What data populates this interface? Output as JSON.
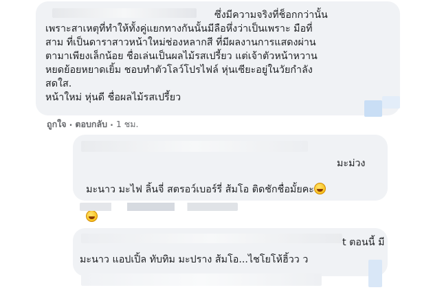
{
  "comment1": {
    "text": "ซึ่งมีความจริงที่ช็อกกว่านั้น\nเพราะสาเหตุที่ทำให้ทั้งคู่แยกทางกันนั้นมีลือหึ่งว่าเป็นเพราะ มือที่\nสาม ที่เป็นดาราสาวหน้าใหม่ช่องหลากสี ที่มีผลงานการแสดงผ่าน\nตามาเพียงเล็กน้อย ชื่อเล่นเป็นผลไม้รสเปรี้ยว แต่เจ้าตัวหน้าหวาน\nหยดย้อยหยาดเยิ้ม ชอบทำตัวโลว์โปรไฟล์ หุ่นเซียะอยู่ในวัยกำลัง\nสดใส.\nหน้าใหม่ หุ่นดี ชื่อผลไม้รสเปรี้ยว",
    "like_label": "ถูกใจ",
    "reply_label": "ตอบกลับ",
    "separator": "·",
    "time": "1 ชม."
  },
  "comment2": {
    "lead_word": "มะม่วง",
    "text": "มะนาว มะไฟ ลิ้นจี่ สตรอว์เบอร์รี่ ส้มโอ ติดชักชื่อมั้ยคะ"
  },
  "comment3": {
    "lead_text": "t ตอนนี้ มี",
    "text": "มะนาว แอปเปิ้ล ทับทิม มะปราง ส้มโอ...ไชโยโห้ฮิ้วว ว"
  },
  "colors": {
    "bubble": "#f0f2f5",
    "text": "#1c1e21",
    "meta": "#65676b",
    "blur_blue": "#c9def5"
  }
}
